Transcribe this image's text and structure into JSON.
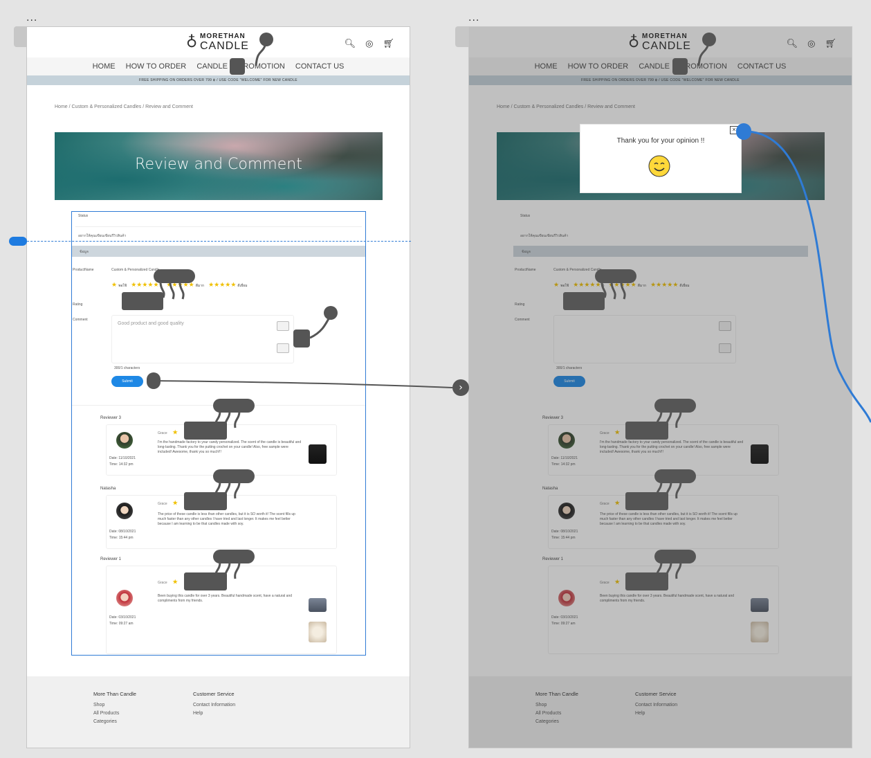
{
  "canvas": {
    "frame_menu": "...",
    "flow_arrow": "›"
  },
  "screen": {
    "logo": {
      "line1": "MORETHAN",
      "line2": "CANDLE"
    },
    "header_icons": [
      "search-icon",
      "user-icon",
      "cart-icon"
    ],
    "nav": [
      "HOME",
      "HOW TO ORDER",
      "CANDLE",
      "PROMOTION",
      "CONTACT US"
    ],
    "promo": "FREE SHIPPING ON ORDERS OVER 799 ฿ / USE CODE \"WELCOME\" FOR NEW CANDLE",
    "breadcrumb": "Home / Custom & Personalized Candles / Review and Comment",
    "banner_title": "Review and Comment",
    "form": {
      "status_label": "Status",
      "name_placeholder": "อยากให้คุณเขียนเขียนรีวิวสินค้า",
      "info_bar": "ข้อมูล",
      "product_label": "ProductName",
      "product_value": "Custom & Personalized Candle",
      "rating_label": "Rating",
      "rating_options": [
        "พอใช้",
        "5",
        "ดีมาก",
        "ดีเยี่ยม"
      ],
      "comment_label": "Comment",
      "attach_label": "Attachments",
      "comment_placeholder": "Good product and good quality",
      "counter": "300/1 characters",
      "submit_label": "Submit"
    },
    "reviews": [
      {
        "section": "Reviewer 3",
        "name": "Grace",
        "date": "Date: 11/10/2021",
        "time": "Time: 14:32 pm",
        "text": "I'm the handmade factory to your candy personalized. The scent of the candle is beautiful and long-lasting. Thank you for the putting crochet on your candle! Also, free sample were included! Awesome, thank you so much!!!"
      },
      {
        "section": "Natasha",
        "name": "Grace",
        "date": "Date: 08/10/2021",
        "time": "Time: 15:44 pm",
        "text": "The price of these candle is less than other candles, but it is SO worth it! The scent fills up much faster than any other candles I have tried and last longer. It makes me feel better because I am learning to be that candles made with soy."
      },
      {
        "section": "Reviewer 1",
        "name": "Grace",
        "date": "Date: 03/10/2021",
        "time": "Time: 09:27 am",
        "text": "Been buying this candle for over 3 years. Beautiful handmade scent, have a natural and compliments from my friends."
      }
    ],
    "footer": {
      "col1": {
        "heading": "More Than Candle",
        "links": [
          "Shop",
          "All Products",
          "Categories"
        ]
      },
      "col2": {
        "heading": "Customer Service",
        "links": [
          "Contact Information",
          "Help"
        ]
      }
    }
  },
  "popup": {
    "message": "Thank you for your opinion !!",
    "emoji": "smiling-face-icon",
    "close": "close-icon"
  },
  "colors": {
    "accent": "#1e88e5",
    "selection": "#2f7bd5",
    "promo_bar": "#c5d2da"
  }
}
